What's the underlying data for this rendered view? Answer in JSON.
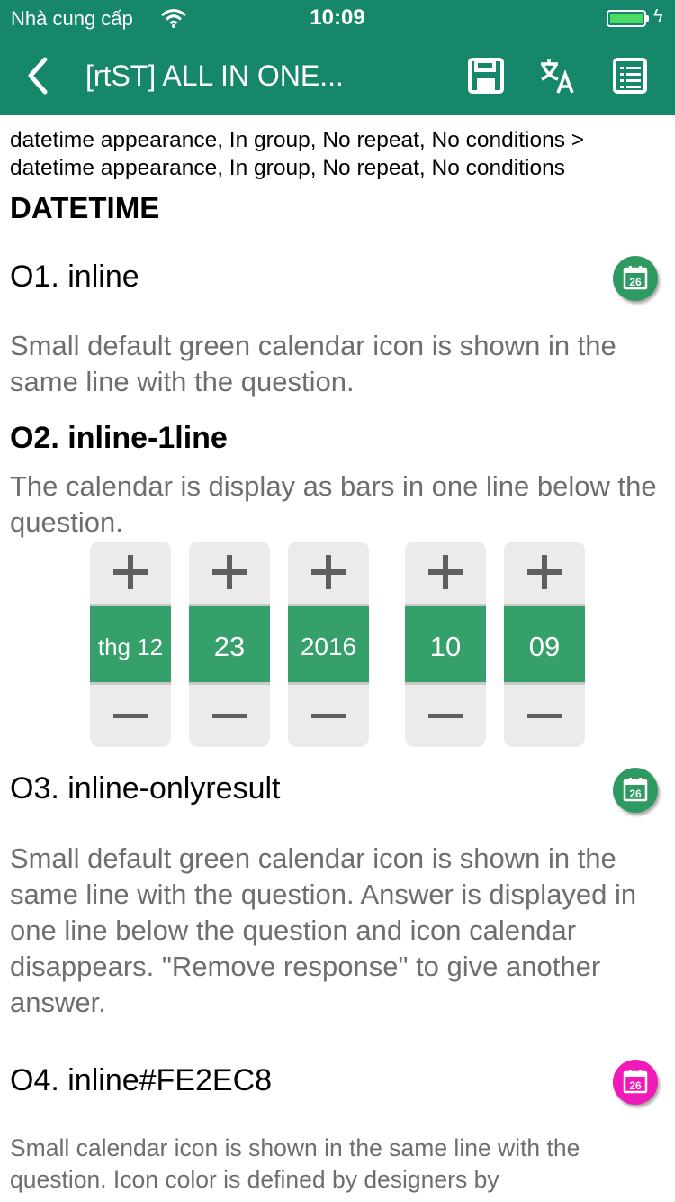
{
  "status_bar": {
    "carrier": "Nhà cung cấp",
    "time": "10:09"
  },
  "app_bar": {
    "title": "[rtST] ALL IN ONE...",
    "icons": [
      "back-chevron-icon",
      "save-icon",
      "translate-icon",
      "list-icon"
    ]
  },
  "breadcrumb": "datetime appearance, In group, No repeat, No conditions > datetime appearance, In group, No repeat, No conditions",
  "section_title": "DATETIME",
  "questions": [
    {
      "label": "O1. inline",
      "hint": "Small default green calendar icon is shown in the same line with the question.",
      "icon_color": "#2e9a61"
    },
    {
      "label": "O2. inline-1line",
      "hint": "The calendar is display as bars in one line below the question."
    },
    {
      "label": "O3. inline-onlyresult",
      "hint": "Small default green calendar icon is shown in the same line with the question. Answer is displayed in one line below the question and icon calendar disappears. \"Remove response\" to give another answer.",
      "icon_color": "#2e9a61"
    },
    {
      "label": "O4. inline#FE2EC8",
      "hint": "Small calendar icon is shown in the same line with the question. Icon color is defined by designers by",
      "icon_color": "#f01ab8"
    }
  ],
  "calendar_icon_day": "26",
  "picker": {
    "month": "thg 12",
    "day": "23",
    "year": "2016",
    "hour": "10",
    "minute": "09"
  },
  "colors": {
    "app_bar": "#16876b",
    "picker_value_bg": "#36a06b",
    "hint_text": "#6e6e6e"
  }
}
